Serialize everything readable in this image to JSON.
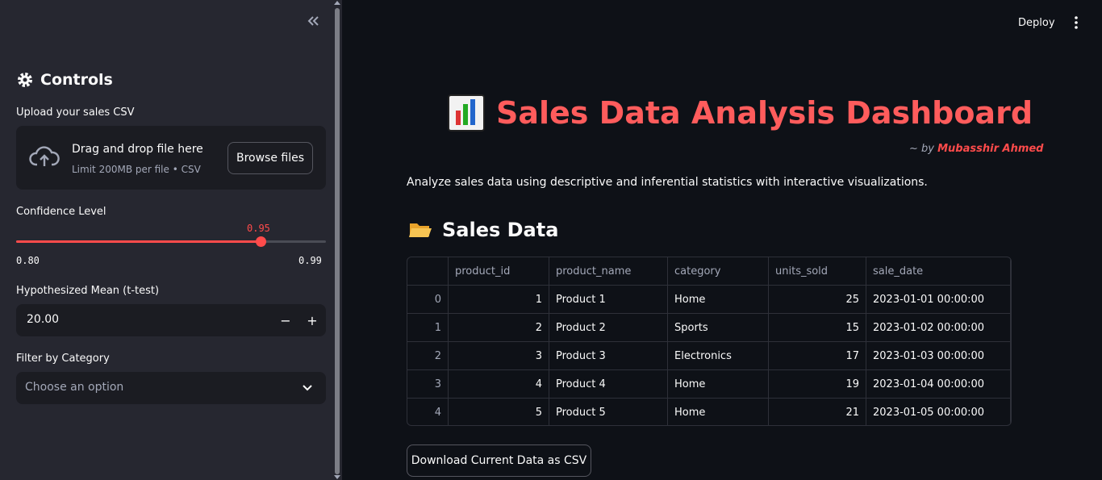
{
  "header": {
    "deploy_label": "Deploy"
  },
  "sidebar": {
    "title": "Controls",
    "upload": {
      "label": "Upload your sales CSV",
      "drag_text": "Drag and drop file here",
      "limit_text": "Limit 200MB per file • CSV",
      "browse_label": "Browse files"
    },
    "confidence": {
      "label": "Confidence Level",
      "value": "0.95",
      "min": "0.80",
      "max": "0.99",
      "fraction": 0.7895
    },
    "hyp_mean": {
      "label": "Hypothesized Mean (t-test)",
      "value": "20.00",
      "minus": "−",
      "plus": "+"
    },
    "category_filter": {
      "label": "Filter by Category",
      "placeholder": "Choose an option"
    }
  },
  "main": {
    "title": "Sales Data Analysis Dashboard",
    "byline_prefix": "~ by ",
    "author": "Mubasshir Ahmed",
    "description": "Analyze sales data using descriptive and inferential statistics with interactive visualizations.",
    "section_title": "Sales Data",
    "table": {
      "columns": [
        "",
        "product_id",
        "product_name",
        "category",
        "units_sold",
        "sale_date"
      ],
      "rows": [
        [
          "0",
          "1",
          "Product 1",
          "Home",
          "25",
          "2023-01-01 00:00:00"
        ],
        [
          "1",
          "2",
          "Product 2",
          "Sports",
          "15",
          "2023-01-02 00:00:00"
        ],
        [
          "2",
          "3",
          "Product 3",
          "Electronics",
          "17",
          "2023-01-03 00:00:00"
        ],
        [
          "3",
          "4",
          "Product 4",
          "Home",
          "19",
          "2023-01-04 00:00:00"
        ],
        [
          "4",
          "5",
          "Product 5",
          "Home",
          "21",
          "2023-01-05 00:00:00"
        ]
      ]
    },
    "download_label": "Download Current Data as CSV"
  },
  "colors": {
    "accent": "#ff4b4b",
    "title": "#ff5c5c",
    "sidebar_bg": "#262730",
    "main_bg": "#0e1117"
  }
}
